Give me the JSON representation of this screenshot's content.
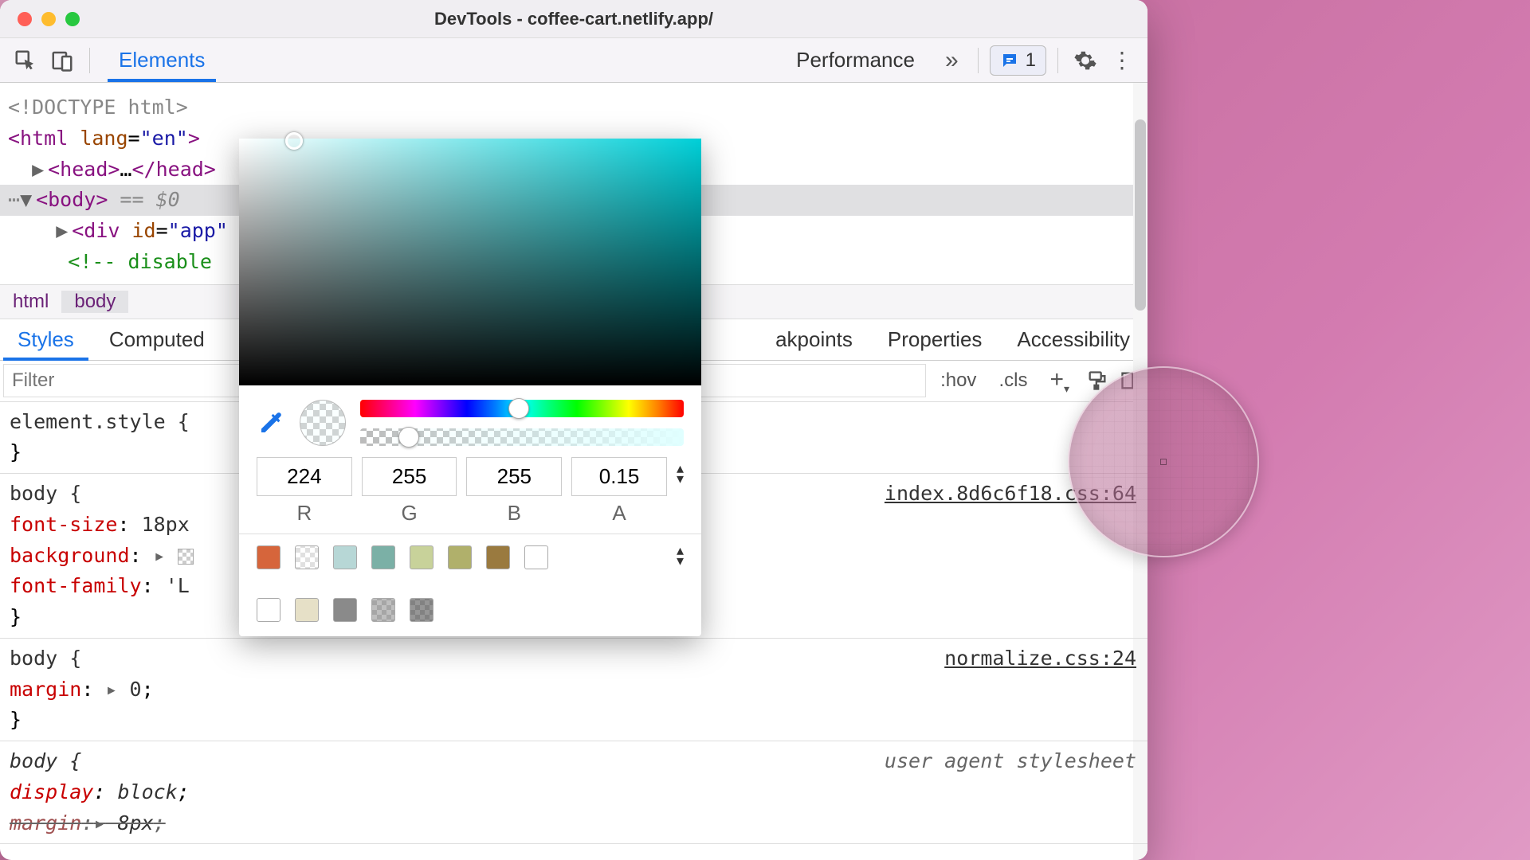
{
  "window": {
    "title": "DevTools - coffee-cart.netlify.app/"
  },
  "toolbar": {
    "tabs": [
      "Elements",
      "Performance"
    ],
    "active_tab": 0,
    "issues_count": "1"
  },
  "dom": {
    "doctype": "<!DOCTYPE html>",
    "html_open": "<html lang=\"en\">",
    "head": "<head>…</head>",
    "body_sel": "<body>",
    "body_aux": " == $0",
    "div": "<div id=\"app\"",
    "comment_partial": "<!-- disable",
    "comment_tail": ">"
  },
  "breadcrumb": {
    "items": [
      "html",
      "body"
    ],
    "active": 1
  },
  "subtabs": {
    "items": [
      "Styles",
      "Computed",
      "akpoints",
      "Properties",
      "Accessibility"
    ],
    "active": 0
  },
  "filter": {
    "placeholder": "Filter",
    "hov": ":hov",
    "cls": ".cls"
  },
  "styles": {
    "element_style_sel": "element.style {",
    "close": "}",
    "rule1": {
      "sel": "body {",
      "src": "index.8d6c6f18.css:64",
      "p1": "font-size",
      "v1": "18px",
      "p2": "background",
      "v2_partial": "",
      "p3": "font-family",
      "v3_partial": "'L"
    },
    "rule2": {
      "sel": "body {",
      "src": "normalize.css:24",
      "p1": "margin",
      "v1": "0"
    },
    "rule3": {
      "sel": "body {",
      "src": "user agent stylesheet",
      "p1": "display",
      "v1": "block",
      "p2": "margin",
      "v2": "8px"
    }
  },
  "picker": {
    "r": "224",
    "g": "255",
    "b": "255",
    "a": "0.15",
    "labels": {
      "r": "R",
      "g": "G",
      "b": "B",
      "a": "A"
    },
    "swatches_row1": [
      "#d6653b",
      "",
      "#b7d7d6",
      "#7bb0a6",
      "#c8d29a",
      "#b0b06b",
      "#9a7a3f",
      "#ffffff"
    ],
    "swatches_row2": [
      "#ffffff",
      "#e6e0c7",
      "#8a8a8a",
      "",
      ""
    ]
  }
}
